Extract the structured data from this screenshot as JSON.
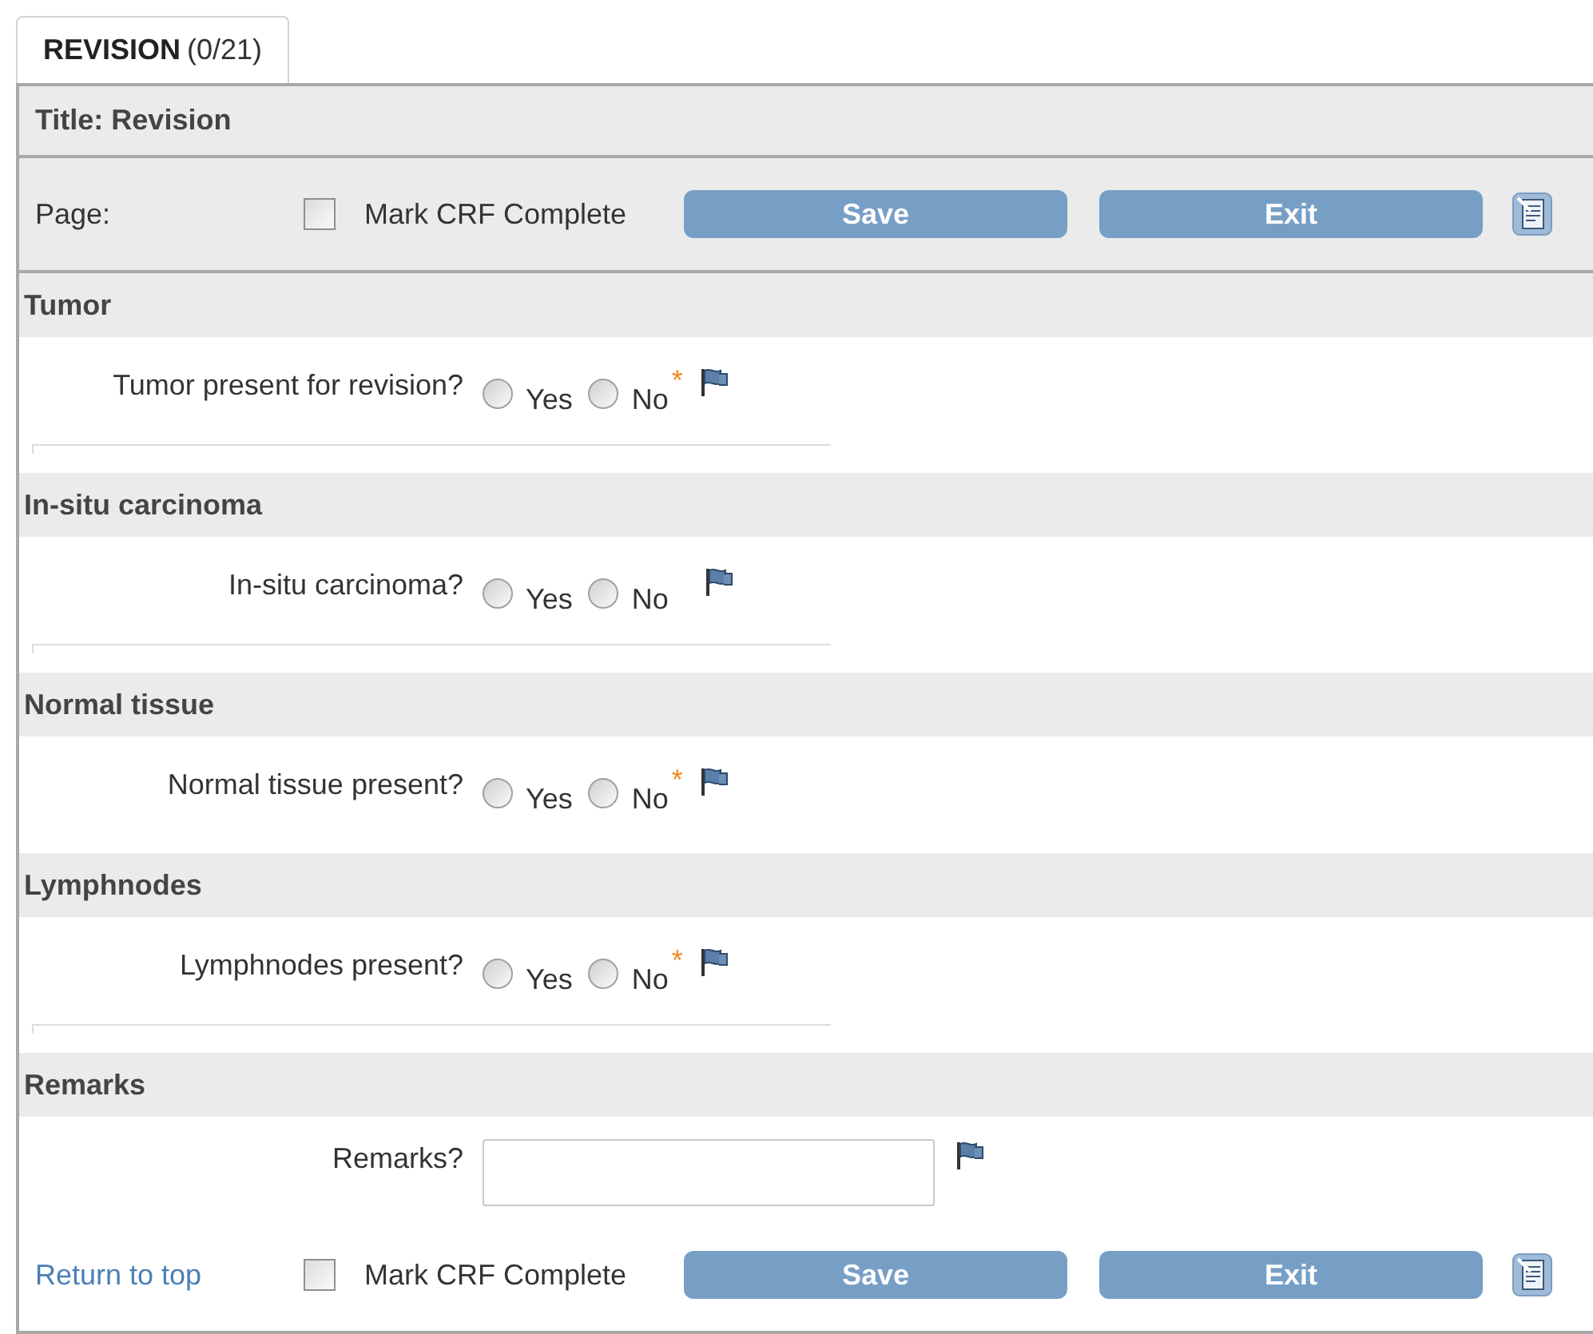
{
  "tab": {
    "label": "REVISION",
    "count": "(0/21)",
    "selected": true
  },
  "title": "Title: Revision",
  "toolbar": {
    "page_label": "Page:",
    "mark_complete": {
      "label": "Mark CRF Complete",
      "checked": false
    },
    "save": "Save",
    "exit": "Exit"
  },
  "sections": [
    {
      "heading": "Tumor",
      "questions": [
        {
          "kind": "radio",
          "label": "Tumor present for revision?",
          "options": [
            {
              "label": "Yes",
              "selected": false
            },
            {
              "label": "No",
              "selected": false
            }
          ],
          "required_mark": "*",
          "divider": true
        }
      ]
    },
    {
      "heading": "In-situ carcinoma",
      "questions": [
        {
          "kind": "radio",
          "label": "In-situ carcinoma?",
          "options": [
            {
              "label": "Yes",
              "selected": false
            },
            {
              "label": "No",
              "selected": false
            }
          ],
          "divider": true
        }
      ]
    },
    {
      "heading": "Normal tissue",
      "questions": [
        {
          "kind": "radio",
          "label": "Normal tissue present?",
          "options": [
            {
              "label": "Yes",
              "selected": false
            },
            {
              "label": "No",
              "selected": false
            }
          ],
          "required_mark": "*",
          "divider": false
        }
      ]
    },
    {
      "heading": "Lymphnodes",
      "questions": [
        {
          "kind": "radio",
          "label": "Lymphnodes present?",
          "options": [
            {
              "label": "Yes",
              "selected": false
            },
            {
              "label": "No",
              "selected": false
            }
          ],
          "required_mark": "*",
          "divider": true
        }
      ]
    },
    {
      "heading": "Remarks",
      "questions": [
        {
          "kind": "text",
          "label": "Remarks?",
          "divider": false
        }
      ]
    }
  ],
  "footer": {
    "link": "Return to top",
    "mark_complete": {
      "label": "Mark CRF Complete",
      "checked": false
    },
    "save": "Save",
    "exit": "Exit"
  }
}
